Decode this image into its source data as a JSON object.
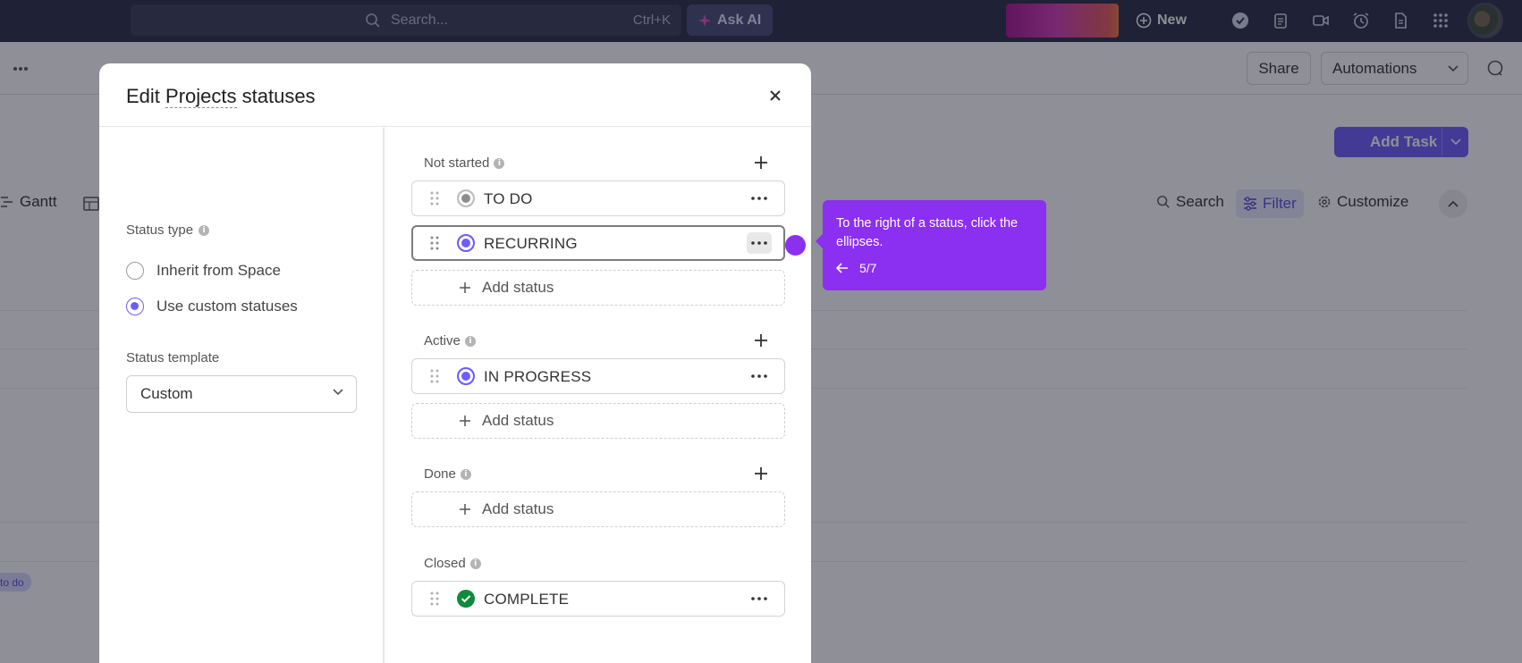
{
  "topbar": {
    "search_placeholder": "Search...",
    "search_shortcut": "Ctrl+K",
    "ask_ai_label": "Ask AI",
    "new_label": "New",
    "icons": [
      "check-circle-icon",
      "clipboard-icon",
      "video-icon",
      "alarm-icon",
      "document-icon",
      "apps-grid-icon"
    ]
  },
  "background": {
    "share_label": "Share",
    "automations_label": "Automations",
    "add_task_label": "Add Task",
    "views": {
      "gantt_label": "Gantt"
    },
    "toolbar": {
      "search_label": "Search",
      "filter_label": "Filter",
      "customize_label": "Customize"
    },
    "tag_label": "to do"
  },
  "modal": {
    "title_prefix": "Edit ",
    "title_link": "Projects",
    "title_suffix": " statuses",
    "status_type_label": "Status type",
    "radio_inherit": "Inherit from Space",
    "radio_custom": "Use custom statuses",
    "status_template_label": "Status template",
    "template_value": "Custom",
    "groups": {
      "not_started": "Not started",
      "active": "Active",
      "done": "Done",
      "closed": "Closed"
    },
    "statuses": {
      "todo": "TO DO",
      "recurring": "RECURRING",
      "in_progress": "IN PROGRESS",
      "complete": "COMPLETE"
    },
    "add_status_label": "Add status"
  },
  "tooltip": {
    "text": "To the right of a status, click the ellipses.",
    "step": "5/7"
  },
  "colors": {
    "accent": "#6d5dfc",
    "tooltip": "#8b2ff0",
    "complete": "#0f8a3c",
    "topbar": "#2b2d45"
  }
}
